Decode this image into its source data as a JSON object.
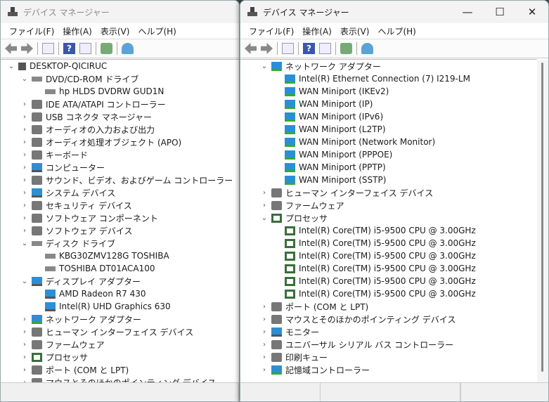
{
  "left_window": {
    "title": "デバイス マネージャー",
    "menu": [
      "ファイル(F)",
      "操作(A)",
      "表示(V)",
      "ヘルプ(H)"
    ],
    "tree": [
      {
        "label": "DESKTOP-QICIRUC",
        "level": 0,
        "state": "expanded",
        "icon": "pc"
      },
      {
        "label": "DVD/CD-ROM ドライブ",
        "level": 1,
        "state": "expanded",
        "icon": "disk"
      },
      {
        "label": "hp HLDS DVDRW  GUD1N",
        "level": 2,
        "state": "leaf",
        "icon": "disk"
      },
      {
        "label": "IDE ATA/ATAPI コントローラー",
        "level": 1,
        "state": "collapsed",
        "icon": "gen"
      },
      {
        "label": "USB コネクタ マネージャー",
        "level": 1,
        "state": "collapsed",
        "icon": "gen"
      },
      {
        "label": "オーディオの入力および出力",
        "level": 1,
        "state": "collapsed",
        "icon": "gen"
      },
      {
        "label": "オーディオ処理オブジェクト (APO)",
        "level": 1,
        "state": "collapsed",
        "icon": "gen"
      },
      {
        "label": "キーボード",
        "level": 1,
        "state": "collapsed",
        "icon": "gen"
      },
      {
        "label": "コンピューター",
        "level": 1,
        "state": "collapsed",
        "icon": "mon"
      },
      {
        "label": "サウンド、ビデオ、およびゲーム コントローラー",
        "level": 1,
        "state": "collapsed",
        "icon": "gen"
      },
      {
        "label": "システム デバイス",
        "level": 1,
        "state": "collapsed",
        "icon": "mon"
      },
      {
        "label": "セキュリティ デバイス",
        "level": 1,
        "state": "collapsed",
        "icon": "gen"
      },
      {
        "label": "ソフトウェア コンポーネント",
        "level": 1,
        "state": "collapsed",
        "icon": "gen"
      },
      {
        "label": "ソフトウェア デバイス",
        "level": 1,
        "state": "collapsed",
        "icon": "gen"
      },
      {
        "label": "ディスク ドライブ",
        "level": 1,
        "state": "expanded",
        "icon": "disk"
      },
      {
        "label": "KBG30ZMV128G TOSHIBA",
        "level": 2,
        "state": "leaf",
        "icon": "disk"
      },
      {
        "label": "TOSHIBA DT01ACA100",
        "level": 2,
        "state": "leaf",
        "icon": "disk"
      },
      {
        "label": "ディスプレイ アダプター",
        "level": 1,
        "state": "expanded",
        "icon": "mon"
      },
      {
        "label": "AMD Radeon R7 430",
        "level": 2,
        "state": "leaf",
        "icon": "mon"
      },
      {
        "label": "Intel(R) UHD Graphics 630",
        "level": 2,
        "state": "leaf",
        "icon": "mon"
      },
      {
        "label": "ネットワーク アダプター",
        "level": 1,
        "state": "collapsed",
        "icon": "net"
      },
      {
        "label": "ヒューマン インターフェイス デバイス",
        "level": 1,
        "state": "collapsed",
        "icon": "gen"
      },
      {
        "label": "ファームウェア",
        "level": 1,
        "state": "collapsed",
        "icon": "gen"
      },
      {
        "label": "プロセッサ",
        "level": 1,
        "state": "collapsed",
        "icon": "cpu"
      },
      {
        "label": "ポート (COM と LPT)",
        "level": 1,
        "state": "collapsed",
        "icon": "gen"
      },
      {
        "label": "マウスとそのほかのポインティング デバイス",
        "level": 1,
        "state": "collapsed",
        "icon": "gen"
      }
    ]
  },
  "right_window": {
    "title": "デバイス マネージャー",
    "controls": [
      "—",
      "☐",
      "✕"
    ],
    "menu": [
      "ファイル(F)",
      "操作(A)",
      "表示(V)",
      "ヘルプ(H)"
    ],
    "tree": [
      {
        "label": "ネットワーク アダプター",
        "level": 1,
        "state": "expanded",
        "icon": "net"
      },
      {
        "label": "Intel(R) Ethernet Connection (7) I219-LM",
        "level": 2,
        "state": "leaf",
        "icon": "net"
      },
      {
        "label": "WAN Miniport (IKEv2)",
        "level": 2,
        "state": "leaf",
        "icon": "net"
      },
      {
        "label": "WAN Miniport (IP)",
        "level": 2,
        "state": "leaf",
        "icon": "net"
      },
      {
        "label": "WAN Miniport (IPv6)",
        "level": 2,
        "state": "leaf",
        "icon": "net"
      },
      {
        "label": "WAN Miniport (L2TP)",
        "level": 2,
        "state": "leaf",
        "icon": "net"
      },
      {
        "label": "WAN Miniport (Network Monitor)",
        "level": 2,
        "state": "leaf",
        "icon": "net"
      },
      {
        "label": "WAN Miniport (PPPOE)",
        "level": 2,
        "state": "leaf",
        "icon": "net"
      },
      {
        "label": "WAN Miniport (PPTP)",
        "level": 2,
        "state": "leaf",
        "icon": "net"
      },
      {
        "label": "WAN Miniport (SSTP)",
        "level": 2,
        "state": "leaf",
        "icon": "net"
      },
      {
        "label": "ヒューマン インターフェイス デバイス",
        "level": 1,
        "state": "collapsed",
        "icon": "gen"
      },
      {
        "label": "ファームウェア",
        "level": 1,
        "state": "collapsed",
        "icon": "gen"
      },
      {
        "label": "プロセッサ",
        "level": 1,
        "state": "expanded",
        "icon": "cpu"
      },
      {
        "label": "Intel(R) Core(TM) i5-9500 CPU @ 3.00GHz",
        "level": 2,
        "state": "leaf",
        "icon": "cpu"
      },
      {
        "label": "Intel(R) Core(TM) i5-9500 CPU @ 3.00GHz",
        "level": 2,
        "state": "leaf",
        "icon": "cpu"
      },
      {
        "label": "Intel(R) Core(TM) i5-9500 CPU @ 3.00GHz",
        "level": 2,
        "state": "leaf",
        "icon": "cpu"
      },
      {
        "label": "Intel(R) Core(TM) i5-9500 CPU @ 3.00GHz",
        "level": 2,
        "state": "leaf",
        "icon": "cpu"
      },
      {
        "label": "Intel(R) Core(TM) i5-9500 CPU @ 3.00GHz",
        "level": 2,
        "state": "leaf",
        "icon": "cpu"
      },
      {
        "label": "Intel(R) Core(TM) i5-9500 CPU @ 3.00GHz",
        "level": 2,
        "state": "leaf",
        "icon": "cpu"
      },
      {
        "label": "ポート (COM と LPT)",
        "level": 1,
        "state": "collapsed",
        "icon": "gen"
      },
      {
        "label": "マウスとそのほかのポインティング デバイス",
        "level": 1,
        "state": "collapsed",
        "icon": "gen"
      },
      {
        "label": "モニター",
        "level": 1,
        "state": "collapsed",
        "icon": "mon"
      },
      {
        "label": "ユニバーサル シリアル バス コントローラー",
        "level": 1,
        "state": "collapsed",
        "icon": "gen"
      },
      {
        "label": "印刷キュー",
        "level": 1,
        "state": "collapsed",
        "icon": "gen"
      },
      {
        "label": "記憶域コントローラー",
        "level": 1,
        "state": "collapsed",
        "icon": "net"
      }
    ]
  }
}
